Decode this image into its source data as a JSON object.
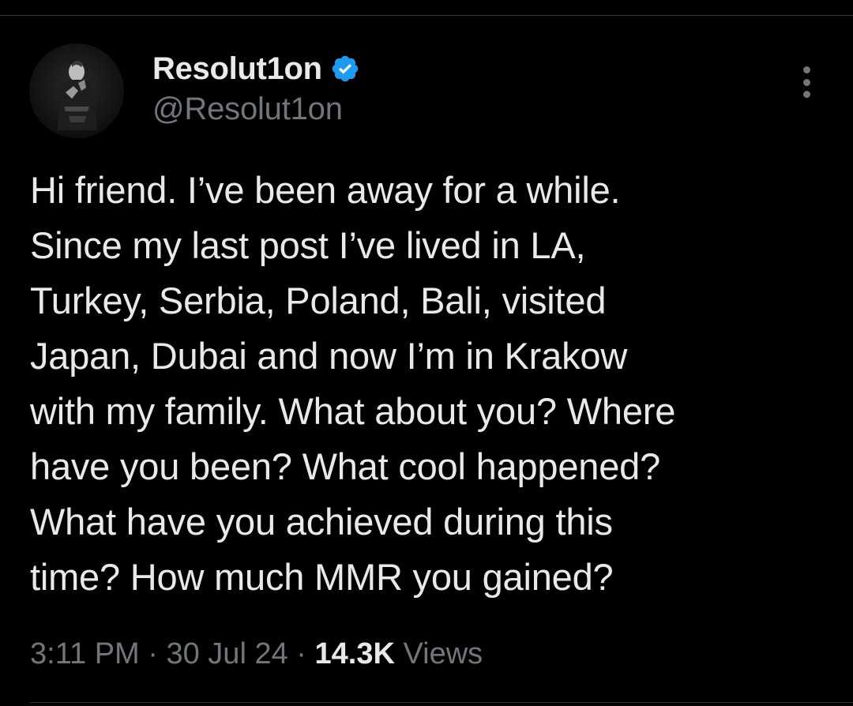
{
  "author": {
    "display_name": "Resolut1on",
    "handle": "@Resolut1on",
    "verified": true,
    "verified_color": "#1d9bf0"
  },
  "more_icon": "more-vertical-icon",
  "tweet": {
    "lines": [
      "Hi friend. I’ve been away for a while.",
      "Since my last post I’ve lived in LA,",
      "Turkey, Serbia, Poland, Bali, visited",
      "Japan, Dubai and now I’m in Krakow",
      "with my family. What about you? Where",
      "have you been? What cool happened?",
      "What have you achieved during this",
      "time? How much MMR you gained?"
    ]
  },
  "meta": {
    "time": "3:11 PM",
    "separator": "·",
    "date": "30 Jul 24",
    "views_count": "14.3K",
    "views_label": "Views"
  },
  "colors": {
    "background": "#000000",
    "text": "#e7e9ea",
    "secondary_text": "#71767b",
    "divider": "#2f3336"
  }
}
